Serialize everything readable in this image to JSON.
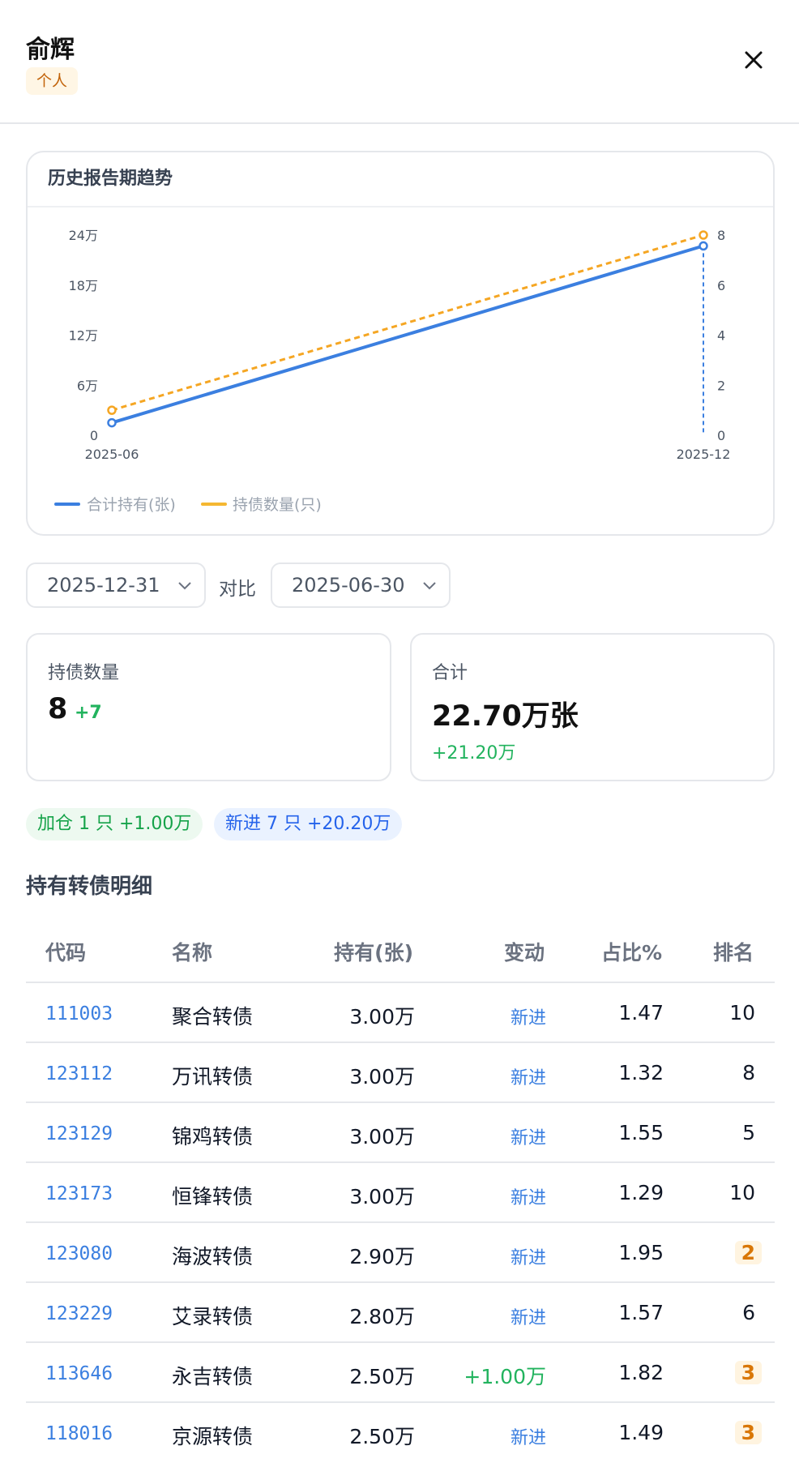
{
  "header": {
    "title": "俞辉",
    "tag": "个人"
  },
  "trend": {
    "title": "历史报告期趋势",
    "legend": [
      {
        "label": "合计持有(张)",
        "color": "#3b7fe0"
      },
      {
        "label": "持债数量(只)",
        "color": "#f5a623"
      }
    ]
  },
  "chart_data": {
    "type": "line",
    "x": [
      "2025-06",
      "2025-12"
    ],
    "y_left_ticks": [
      "24万",
      "18万",
      "12万",
      "6万",
      "0"
    ],
    "y_right_ticks": [
      "8",
      "6",
      "4",
      "2",
      "0"
    ],
    "y_left_lim": [
      0,
      240000
    ],
    "y_right_lim": [
      0,
      8
    ],
    "series": [
      {
        "name": "合计持有(张)",
        "axis": "left",
        "style": "solid",
        "color": "#3b7fe0",
        "values": [
          15000,
          227000
        ]
      },
      {
        "name": "持债数量(只)",
        "axis": "right",
        "style": "dashed",
        "color": "#f5a623",
        "values": [
          1,
          8
        ]
      }
    ]
  },
  "filters": {
    "date_current": "2025-12-31",
    "vs_label": "对比",
    "date_compare": "2025-06-30"
  },
  "stats": {
    "count": {
      "label": "持债数量",
      "value": "8",
      "delta": "+7"
    },
    "total": {
      "label": "合计",
      "value": "22.70万张",
      "delta": "+21.20万"
    }
  },
  "pills": {
    "increase": "加仓 1 只 +1.00万",
    "new": "新进 7 只 +20.20万"
  },
  "detail": {
    "title": "持有转债明细",
    "columns": [
      "代码",
      "名称",
      "持有(张)",
      "变动",
      "占比%",
      "排名"
    ],
    "rows": [
      {
        "code": "111003",
        "name": "聚合转债",
        "hold": "3.00万",
        "change": "新进",
        "pct": "1.47",
        "rank": "10"
      },
      {
        "code": "123112",
        "name": "万讯转债",
        "hold": "3.00万",
        "change": "新进",
        "pct": "1.32",
        "rank": "8"
      },
      {
        "code": "123129",
        "name": "锦鸡转债",
        "hold": "3.00万",
        "change": "新进",
        "pct": "1.55",
        "rank": "5"
      },
      {
        "code": "123173",
        "name": "恒锋转债",
        "hold": "3.00万",
        "change": "新进",
        "pct": "1.29",
        "rank": "10"
      },
      {
        "code": "123080",
        "name": "海波转债",
        "hold": "2.90万",
        "change": "新进",
        "pct": "1.95",
        "rank": "2"
      },
      {
        "code": "123229",
        "name": "艾录转债",
        "hold": "2.80万",
        "change": "新进",
        "pct": "1.57",
        "rank": "6"
      },
      {
        "code": "113646",
        "name": "永吉转债",
        "hold": "2.50万",
        "change": "+1.00万",
        "pct": "1.82",
        "rank": "3"
      },
      {
        "code": "118016",
        "name": "京源转债",
        "hold": "2.50万",
        "change": "新进",
        "pct": "1.49",
        "rank": "3"
      }
    ]
  },
  "colors": {
    "new_change": "#3b7fe0",
    "plus_change": "#22b35e",
    "rank_highlight": "#d97706"
  }
}
